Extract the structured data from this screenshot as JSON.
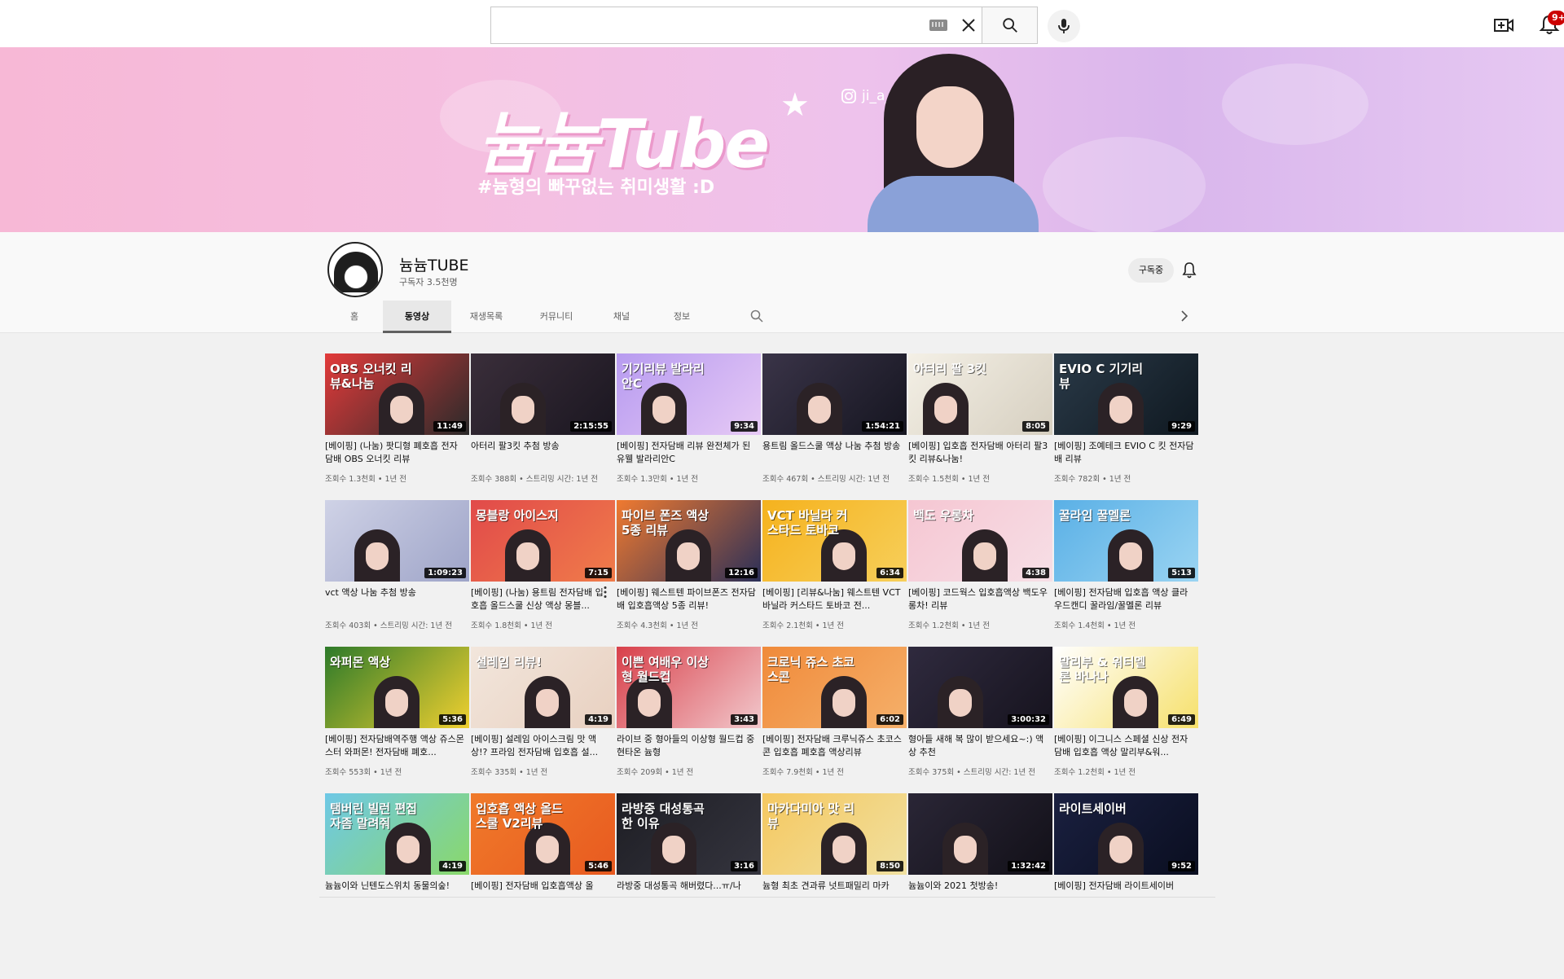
{
  "search": {
    "placeholder": "",
    "value": ""
  },
  "notifications": {
    "count": "9+"
  },
  "banner": {
    "title": "늄늄Tube",
    "subtitle": "#늄형의 빠꾸없는 취미생활 :D",
    "instagram": "ji_a_93"
  },
  "channel": {
    "name": "늄늄TUBE",
    "subscribers": "구독자 3.5천명",
    "subscribe_label": "구독중"
  },
  "tabs": [
    {
      "label": "홈"
    },
    {
      "label": "동영상",
      "active": true
    },
    {
      "label": "재생목록"
    },
    {
      "label": "커뮤니티"
    },
    {
      "label": "채널"
    },
    {
      "label": "정보"
    }
  ],
  "videos": [
    {
      "title": "[베이핑] (나눔) 팟디형 폐호흡 전자담배 OBS 오너킷 리뷰",
      "meta": "조회수 1.3천회 • 1년 전",
      "duration": "11:49",
      "thumb_text": "OBS 오너킷 리뷰&나눔",
      "colors": [
        "#e23a3a",
        "#2a2a2a"
      ]
    },
    {
      "title": "아터리 팔3킷 추첨 방송",
      "meta": "조회수 388회 • 스트리밍 시간: 1년 전",
      "duration": "2:15:55",
      "thumb_text": "",
      "colors": [
        "#3a2e3a",
        "#1a1620"
      ]
    },
    {
      "title": "[베이핑] 전자담배 리뷰 완전체가 된 유웰 발라리안C",
      "meta": "조회수 1.3만회 • 1년 전",
      "duration": "9:34",
      "thumb_text": "기기리뷰 발라리안C",
      "colors": [
        "#b79bf0",
        "#e6c9f5"
      ]
    },
    {
      "title": "용트림 올드스쿨 액상 나눔 추첨 방송",
      "meta": "조회수 467회 • 스트리밍 시간: 1년 전",
      "duration": "1:54:21",
      "thumb_text": "",
      "colors": [
        "#3a3448",
        "#151520"
      ]
    },
    {
      "title": "[베이핑] 입호흡 전자담배 아터리 팔3킷 리뷰&나눔!",
      "meta": "조회수 1.5천회 • 1년 전",
      "duration": "8:05",
      "thumb_text": "아터리 팔 3킷",
      "colors": [
        "#f4f0e6",
        "#d6cfc0"
      ]
    },
    {
      "title": "[베이핑] 조예테크 EVIO C 킷 전자담배 리뷰",
      "meta": "조회수 782회 • 1년 전",
      "duration": "9:29",
      "thumb_text": "EVIO C 기기리뷰",
      "colors": [
        "#2a3a48",
        "#0f1820"
      ]
    },
    {
      "title": "vct 액상 나눔 추첨 방송",
      "meta": "조회수 403회 • 스트리밍 시간: 1년 전",
      "duration": "1:09:23",
      "thumb_text": "",
      "colors": [
        "#cfd2e6",
        "#9ea4c8"
      ]
    },
    {
      "title": "[베이핑] (나눔) 용트림 전자담배 입호흡 올드스쿨 신상 액상 몽블...",
      "meta": "조회수 1.8천회 • 1년 전",
      "duration": "7:15",
      "thumb_text": "몽블랑 아이스지",
      "colors": [
        "#e14a4a",
        "#f07c4a"
      ]
    },
    {
      "title": "[베이핑] 웨스트텐 파이브폰즈 전자담배 입호흡액상 5종 리뷰!",
      "meta": "조회수 4.3천회 • 1년 전",
      "duration": "12:16",
      "thumb_text": "파이브 폰즈 액상 5종 리뷰",
      "colors": [
        "#f07a30",
        "#2a2f58"
      ]
    },
    {
      "title": "[베이핑] [리뷰&나눔] 웨스트텐 VCT 바닐라 커스타드 토바코 전...",
      "meta": "조회수 2.1천회 • 1년 전",
      "duration": "6:34",
      "thumb_text": "VCT 바닐라 커스타드 토바코",
      "colors": [
        "#f5b21e",
        "#f7cf5a"
      ]
    },
    {
      "title": "[베이핑] 코드웍스 입호흡액상 백도우롱차! 리뷰",
      "meta": "조회수 1.2천회 • 1년 전",
      "duration": "4:38",
      "thumb_text": "백도 우롱차",
      "colors": [
        "#f5c6d2",
        "#f7dfe6"
      ]
    },
    {
      "title": "[베이핑] 전자담배 입호흡 액상 클라우드캔디 꿀라임/꿀멜론 리뷰",
      "meta": "조회수 1.4천회 • 1년 전",
      "duration": "5:13",
      "thumb_text": "꿀라임 꿀멜론",
      "colors": [
        "#5ab0e6",
        "#9ad4f2"
      ]
    },
    {
      "title": "[베이핑] 전자담배역주행 액상 쥬스몬스터 와퍼몬! 전자담배 폐호...",
      "meta": "조회수 553회 • 1년 전",
      "duration": "5:36",
      "thumb_text": "와퍼몬 액상",
      "colors": [
        "#2d7a2a",
        "#f0d030"
      ]
    },
    {
      "title": "[베이핑] 설레임 아이스크림 맛 액상!? 프라임 전자담배 입호흡 설...",
      "meta": "조회수 335회 • 1년 전",
      "duration": "4:19",
      "thumb_text": "설레임 리뷰!",
      "colors": [
        "#f2e6dc",
        "#e8d0c0"
      ]
    },
    {
      "title": "라이브 중 형아들의 이상형 월드컵 중 현타온 늄형",
      "meta": "조회수 209회 • 1년 전",
      "duration": "3:43",
      "thumb_text": "이쁜 여배우 이상형 월드컵",
      "colors": [
        "#d8404a",
        "#f2c8cc"
      ]
    },
    {
      "title": "[베이핑] 전자담배 크루닉쥬스 초코스콘 입호흡 폐호흡 액상리뷰",
      "meta": "조회수 7.9천회 • 1년 전",
      "duration": "6:02",
      "thumb_text": "크로닉 쥬스 초코 스콘",
      "colors": [
        "#f08a3a",
        "#f5b06a"
      ]
    },
    {
      "title": "형아들 새해 복 많이 받으세요~:) 액상 추천",
      "meta": "조회수 375회 • 스트리밍 시간: 1년 전",
      "duration": "3:00:32",
      "thumb_text": "",
      "colors": [
        "#2f2a3e",
        "#16131e"
      ]
    },
    {
      "title": "[베이핑] 이그니스 스페셜 신상 전자담배 입호흡 액상 말리부&워...",
      "meta": "조회수 1.2천회 • 1년 전",
      "duration": "6:49",
      "thumb_text": "말리부 & 워터멜론 바나나",
      "colors": [
        "#ffffff",
        "#f6e06a"
      ]
    },
    {
      "title": "늄늄이와 닌텐도스위치 동물의숲!",
      "meta": "",
      "duration": "4:19",
      "thumb_text": "탬버린 빌런 편집자좀 말려줘",
      "colors": [
        "#6ec8e6",
        "#8ad86a"
      ]
    },
    {
      "title": "[베이핑] 전자담배 입호흡액상 올",
      "meta": "",
      "duration": "5:46",
      "thumb_text": "입호흡 액상 올드스쿨 V2리뷰",
      "colors": [
        "#f07a2a",
        "#e85a20"
      ]
    },
    {
      "title": "라방중 대성통곡 해버렸다...ㅠ/나",
      "meta": "",
      "duration": "3:16",
      "thumb_text": "라방중 대성통곡한 이유",
      "colors": [
        "#1e1e24",
        "#34343e"
      ]
    },
    {
      "title": "늄형 최초 견과류 넛트패밀리 마카",
      "meta": "",
      "duration": "8:50",
      "thumb_text": "마카다미아 맛 리뷰",
      "colors": [
        "#f5c860",
        "#f0e0a0"
      ]
    },
    {
      "title": "늄늄이와 2021 첫방송!",
      "meta": "",
      "duration": "1:32:42",
      "thumb_text": "",
      "colors": [
        "#2a2636",
        "#121018"
      ]
    },
    {
      "title": "[베이핑] 전자담배 라이트세이버",
      "meta": "",
      "duration": "9:52",
      "thumb_text": "라이트세이버",
      "colors": [
        "#1a2040",
        "#0a0e20"
      ]
    }
  ]
}
